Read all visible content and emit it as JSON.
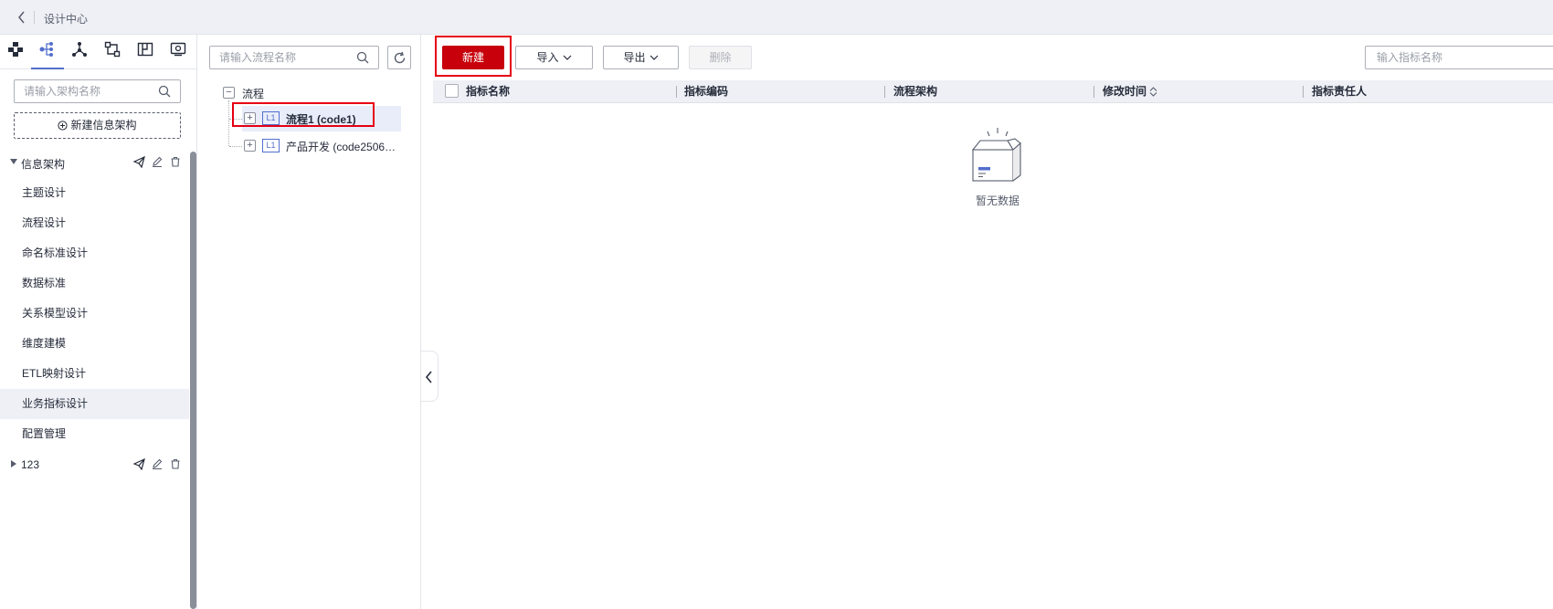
{
  "header": {
    "title": "设计中心"
  },
  "sidebar": {
    "icon_tabs": [
      "architecture-icon",
      "process-tree-icon",
      "network-icon",
      "data-flow-icon",
      "layout-icon",
      "preview-icon"
    ],
    "search_placeholder": "请输入架构名称",
    "new_button_label": "新建信息架构",
    "group": {
      "label": "信息架构"
    },
    "items": [
      {
        "label": "主题设计"
      },
      {
        "label": "流程设计"
      },
      {
        "label": "命名标准设计"
      },
      {
        "label": "数据标准"
      },
      {
        "label": "关系模型设计"
      },
      {
        "label": "维度建模"
      },
      {
        "label": "ETL映射设计"
      },
      {
        "label": "业务指标设计",
        "active": true
      },
      {
        "label": "配置管理"
      }
    ],
    "group2": {
      "label": "123"
    }
  },
  "tree": {
    "search_placeholder": "请输入流程名称",
    "root_label": "流程",
    "nodes": [
      {
        "tag": "L1",
        "label": "流程1 (code1)",
        "selected": true
      },
      {
        "tag": "L1",
        "label": "产品开发 (code2506…"
      }
    ]
  },
  "toolbar": {
    "new_label": "新建",
    "import_label": "导入",
    "export_label": "导出",
    "delete_label": "删除",
    "search_placeholder": "输入指标名称"
  },
  "table": {
    "columns": [
      "指标名称",
      "指标编码",
      "流程架构",
      "修改时间",
      "指标责任人"
    ]
  },
  "empty": {
    "text": "暂无数据"
  },
  "colors": {
    "primary": "#c7000b",
    "accent": "#526ecc",
    "highlight": "#e60012"
  }
}
